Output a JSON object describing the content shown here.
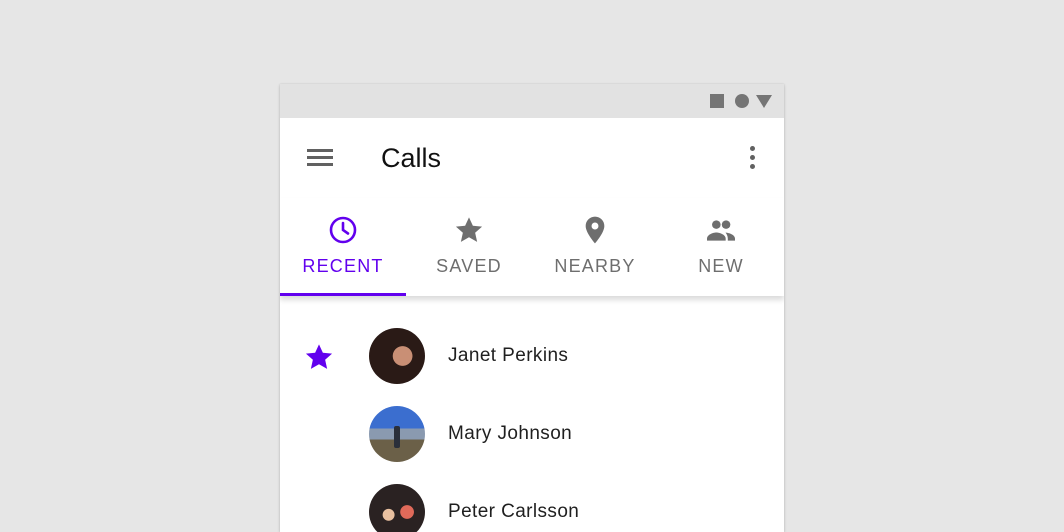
{
  "status_bar": {
    "icons": [
      "square-icon",
      "circle-icon",
      "triangle-icon"
    ]
  },
  "app_bar": {
    "title": "Calls",
    "menu_icon": "menu-icon",
    "overflow_icon": "more-vert-icon"
  },
  "tabs": [
    {
      "label": "RECENT",
      "icon": "clock-icon",
      "active": true
    },
    {
      "label": "SAVED",
      "icon": "star-icon",
      "active": false
    },
    {
      "label": "NEARBY",
      "icon": "location-pin-icon",
      "active": false
    },
    {
      "label": "NEW",
      "icon": "people-icon",
      "active": false
    }
  ],
  "contacts": [
    {
      "name": "Janet Perkins",
      "starred": true
    },
    {
      "name": "Mary Johnson",
      "starred": false
    },
    {
      "name": "Peter Carlsson",
      "starred": false
    }
  ],
  "colors": {
    "accent": "#6200ee",
    "inactive": "#6e6e6e",
    "background": "#e6e6e6",
    "status_bar": "#e2e2e2"
  }
}
